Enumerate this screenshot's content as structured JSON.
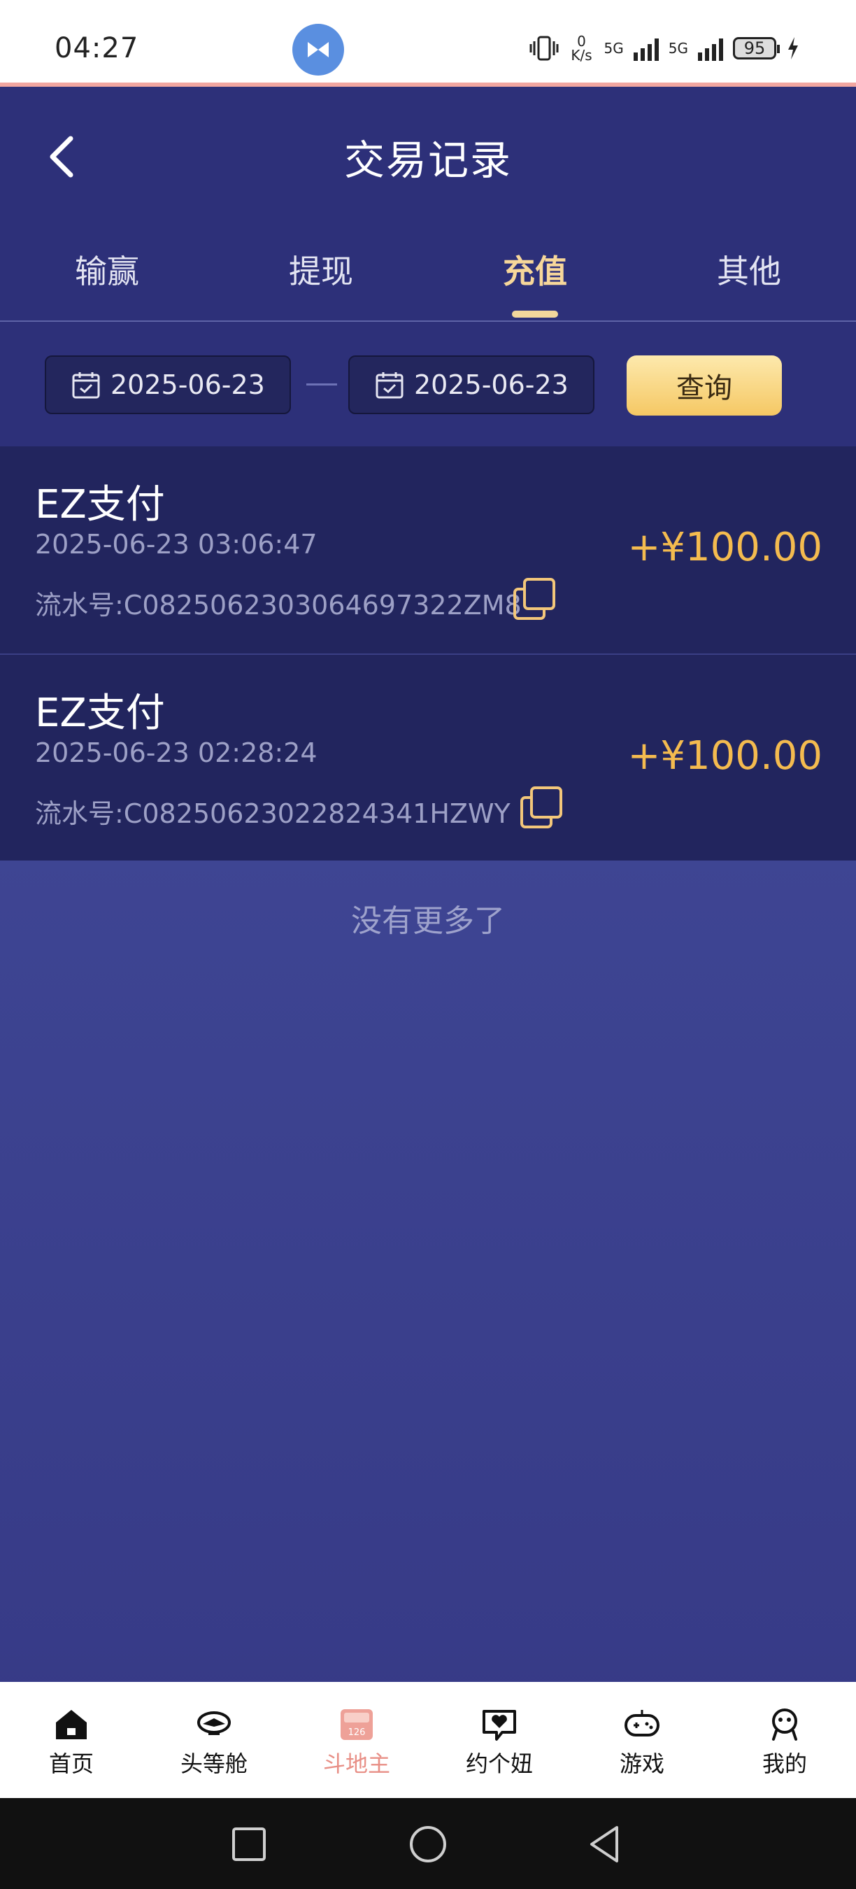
{
  "status_bar": {
    "time": "04:27",
    "net_speed": "0 K/s",
    "signal1": "5G",
    "signal2": "5G",
    "battery": "95"
  },
  "header": {
    "title": "交易记录"
  },
  "tabs": [
    {
      "label": "输赢",
      "active": false
    },
    {
      "label": "提现",
      "active": false
    },
    {
      "label": "充值",
      "active": true
    },
    {
      "label": "其他",
      "active": false
    }
  ],
  "filter": {
    "start_date": "2025-06-23",
    "end_date": "2025-06-23",
    "query_label": "查询"
  },
  "records": [
    {
      "method": "EZ支付",
      "time": "2025-06-23 03:06:47",
      "serial": "流水号:C0825062303064697322ZM8",
      "amount": "+¥100.00"
    },
    {
      "method": "EZ支付",
      "time": "2025-06-23 02:28:24",
      "serial": "流水号:C08250623022824341HZWY",
      "amount": "+¥100.00"
    }
  ],
  "list_end_text": "没有更多了",
  "bottom_nav": [
    {
      "label": "首页",
      "icon": "home-icon"
    },
    {
      "label": "头等舱",
      "icon": "plane-icon"
    },
    {
      "label": "斗地主",
      "icon": "card-game-icon",
      "active": true
    },
    {
      "label": "约个妞",
      "icon": "heart-chat-icon"
    },
    {
      "label": "游戏",
      "icon": "gamepad-icon"
    },
    {
      "label": "我的",
      "icon": "profile-icon"
    }
  ],
  "colors": {
    "header_bg": "#2d3079",
    "accent_gold": "#f4bb4f",
    "active_tab": "#f7d79a",
    "active_nav": "#e88f86"
  }
}
